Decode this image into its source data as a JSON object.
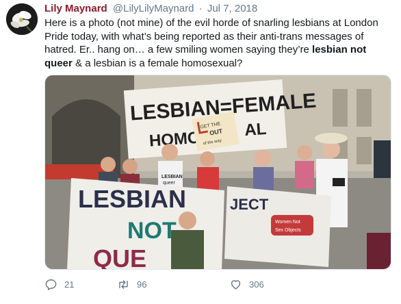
{
  "tweet": {
    "author_name": "Lily Maynard",
    "author_handle": "@LilyLilyMaynard",
    "separator": "·",
    "date": "Jul 7, 2018",
    "text_part1": "Here is a photo (not mine) of the evil horde of snarling lesbians at London Pride today, with what’s being reported as their anti-trans messages of hatred.  Er.. hang on… a few smiling women saying they’re ",
    "text_bold1": "lesbian not queer",
    "text_part2": " & a lesbian is a female homosexual?"
  },
  "photo": {
    "banner_top": "LESBIAN=FEMALE",
    "banner_top_line2": "HOMO",
    "banner_top_line2b": "AL",
    "sign_card_line1": "GET THE",
    "sign_card_line2": "OUT",
    "sign_card_line3": "of the way",
    "banner_left_line1": "LESBIAN",
    "banner_left_line2": "NOT",
    "banner_left_line3": "QUE",
    "banner_right_word": "JECT",
    "banner_right_tag1": "Women Not",
    "banner_right_tag2": "Sex Objects",
    "tshirt_text1": "LESBIAN",
    "tshirt_text2": "queer"
  },
  "actions": {
    "reply_count": "21",
    "retweet_count": "96",
    "like_count": "306"
  },
  "colors": {
    "name": "#8b1a2c",
    "meta": "#657786",
    "text": "#14171a"
  },
  "icons": {
    "reply": "reply-icon",
    "retweet": "retweet-icon",
    "like": "heart-icon"
  }
}
